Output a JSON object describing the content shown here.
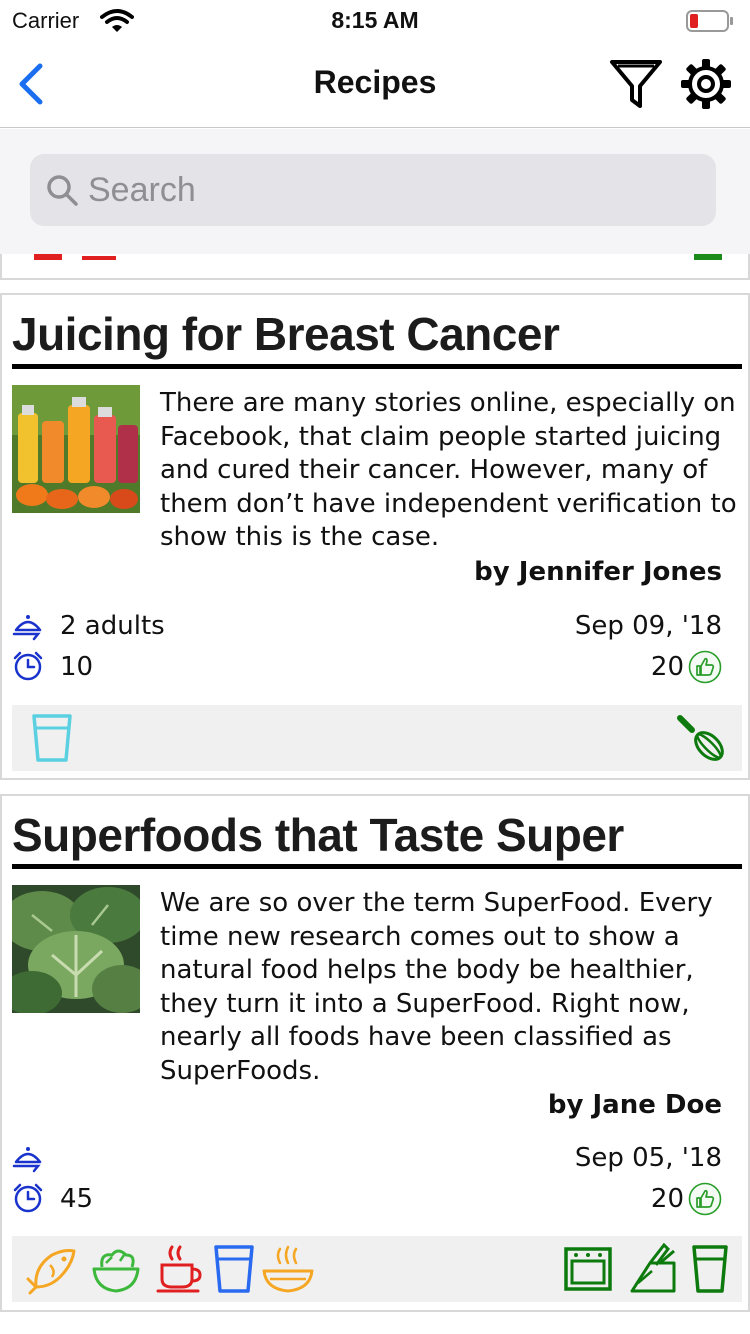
{
  "status_bar": {
    "carrier": "Carrier",
    "time": "8:15 AM"
  },
  "nav": {
    "title": "Recipes",
    "back_icon": "chevron-left-icon",
    "filter_icon": "filter-icon",
    "settings_icon": "gear-icon"
  },
  "search": {
    "placeholder": "Search"
  },
  "colors": {
    "accent": "#1b6ef0",
    "icon_blue": "#1a33cc",
    "like_green": "#2a9d2a",
    "tag_bar": "#f0f0f0"
  },
  "recipes": [
    {
      "title": "Juicing for Breast Cancer",
      "description": "There are many stories online, especially on Facebook, that claim people started juicing and cured their cancer. However, many of them don’t have independent verification to show this is the case.",
      "author": "by Jennifer Jones",
      "servings": "2 adults",
      "time": "10",
      "date": "Sep 09, '18",
      "likes": "20",
      "tags_left": [
        "glass-icon"
      ],
      "tags_right": [
        "whisk-icon"
      ]
    },
    {
      "title": "Superfoods that Taste Super",
      "description": "We are so over the term SuperFood. Every time new research comes out to show a natural food helps the body be healthier, they turn it into a SuperFood. Right now, nearly all foods have been classified as SuperFoods.",
      "author": "by Jane Doe",
      "servings": "",
      "time": "45",
      "date": "Sep 05, '18",
      "likes": "20",
      "tags_left": [
        "fish-icon",
        "salad-bowl-icon",
        "hot-cup-icon",
        "glass-icon",
        "soup-bowl-icon"
      ],
      "tags_right": [
        "oven-icon",
        "knife-block-icon",
        "glass-icon"
      ]
    }
  ]
}
